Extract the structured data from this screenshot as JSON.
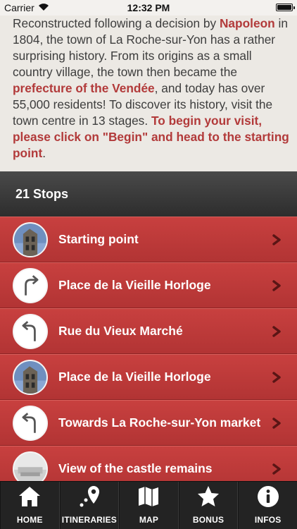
{
  "status_bar": {
    "carrier": "Carrier",
    "time": "12:32 PM"
  },
  "intro": {
    "p1": "Reconstructed following a decision by ",
    "napoleon": "Napoleon",
    "p2": " in 1804, the town of La Roche-sur-Yon has a rather surprising history. From its origins as a small country village, the town then became the ",
    "prefecture": "prefecture of the Vendée",
    "p3": ", and today has over 55,000 residents! To discover its history, visit the town centre in 13 stages. ",
    "cta": "To begin your visit, please click on \"Begin\" and head to the starting point",
    "p4": "."
  },
  "stops_header": "21 Stops",
  "stops": [
    {
      "label": "Starting point",
      "icon": "building-photo"
    },
    {
      "label": "Place de la Vieille Horloge",
      "icon": "turn-right-arrow-icon"
    },
    {
      "label": "Rue du Vieux Marché",
      "icon": "turn-left-arrow-icon"
    },
    {
      "label": "Place de la Vieille Horloge",
      "icon": "building-photo"
    },
    {
      "label": "Towards La Roche-sur-Yon market",
      "icon": "turn-left-arrow-icon"
    },
    {
      "label": "View of the castle remains",
      "icon": "castle-photo"
    }
  ],
  "tabs": [
    {
      "label": "HOME",
      "icon": "home-icon"
    },
    {
      "label": "ITINERARIES",
      "icon": "itineraries-icon"
    },
    {
      "label": "MAP",
      "icon": "map-icon"
    },
    {
      "label": "BONUS",
      "icon": "star-icon"
    },
    {
      "label": "INFOS",
      "icon": "info-icon"
    }
  ],
  "colors": {
    "accent_red": "#b23a3a",
    "list_red": "#c03a3a",
    "tab_bg": "#232323"
  }
}
